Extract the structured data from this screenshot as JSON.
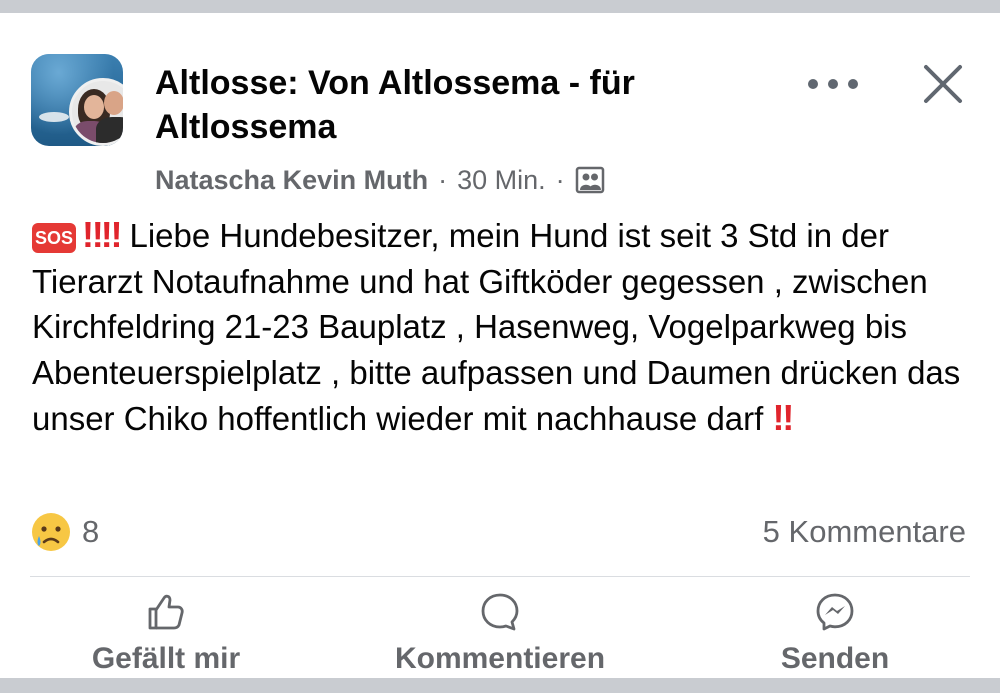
{
  "post": {
    "group_title": "Altlosse: Von Altlossema - für Altlossema",
    "author": "Natascha Kevin Muth",
    "separator": "·",
    "time": "30 Min.",
    "sos_label": "SOS",
    "bang": "‼‼",
    "text": "Liebe Hundebesitzer, mein Hund ist seit 3 Std in der Tierarzt Notaufnahme und hat Giftköder gegessen , zwischen Kirchfeldring 21-23 Bauplatz , Hasenweg, Vogelparkweg bis Abenteuerspielplatz , bitte aufpassen und Daumen drücken das unser Chiko hoffentlich wieder mit nachhause darf",
    "trailing_bang": "‼"
  },
  "stats": {
    "reaction_icon": "sad-crying-emoji",
    "reaction_count": "8",
    "comments": "5 Kommentare"
  },
  "actions": [
    {
      "label": "Gefällt mir",
      "icon": "thumbs-up-icon"
    },
    {
      "label": "Kommentieren",
      "icon": "comment-icon"
    },
    {
      "label": "Senden",
      "icon": "messenger-icon"
    }
  ],
  "colors": {
    "text": "#050505",
    "secondary": "#65676b",
    "alert_red": "#e0242c",
    "background": "#c9ccd1"
  }
}
